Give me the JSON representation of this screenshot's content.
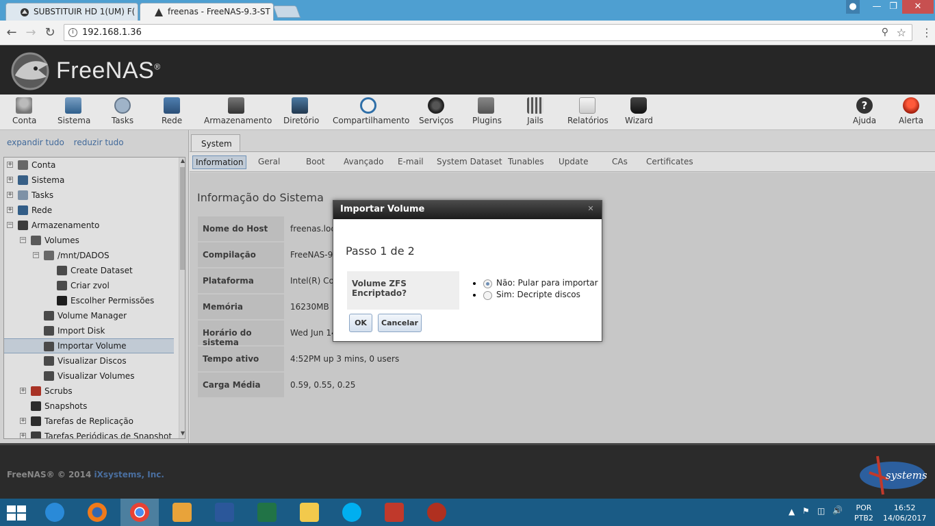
{
  "browser": {
    "tabs": [
      {
        "title": "SUBSTITUIR HD 1(UM) F(",
        "active": false
      },
      {
        "title": "freenas - FreeNAS-9.3-ST",
        "active": true
      }
    ],
    "url": "192.168.1.36"
  },
  "app": {
    "brand": "FreeNAS",
    "brand_mark": "®"
  },
  "toolbar": {
    "items": [
      {
        "label": "Conta",
        "icon": "users-icon"
      },
      {
        "label": "Sistema",
        "icon": "system-icon"
      },
      {
        "label": "Tasks",
        "icon": "tasks-icon"
      },
      {
        "label": "Rede",
        "icon": "network-icon"
      },
      {
        "label": "Armazenamento",
        "icon": "storage-icon"
      },
      {
        "label": "Diretório",
        "icon": "directory-icon"
      },
      {
        "label": "Compartilhamento",
        "icon": "sharing-icon"
      },
      {
        "label": "Serviços",
        "icon": "services-icon"
      },
      {
        "label": "Plugins",
        "icon": "plugins-icon"
      },
      {
        "label": "Jails",
        "icon": "jails-icon"
      },
      {
        "label": "Relatórios",
        "icon": "reports-icon"
      },
      {
        "label": "Wizard",
        "icon": "wizard-icon"
      },
      {
        "label": "Ajuda",
        "icon": "help-icon"
      },
      {
        "label": "Alerta",
        "icon": "alert-icon"
      }
    ]
  },
  "sidebar": {
    "expand_all": "expandir tudo",
    "collapse_all": "reduzir tudo",
    "tree": [
      {
        "label": "Conta",
        "toggle": "+"
      },
      {
        "label": "Sistema",
        "toggle": "+"
      },
      {
        "label": "Tasks",
        "toggle": "+"
      },
      {
        "label": "Rede",
        "toggle": "+"
      },
      {
        "label": "Armazenamento",
        "toggle": "−"
      },
      {
        "label": "Volumes",
        "toggle": "−"
      },
      {
        "label": "/mnt/DADOS",
        "toggle": "−"
      },
      {
        "label": "Create Dataset",
        "toggle": ""
      },
      {
        "label": "Criar zvol",
        "toggle": ""
      },
      {
        "label": "Escolher Permissões",
        "toggle": ""
      },
      {
        "label": "Volume Manager",
        "toggle": ""
      },
      {
        "label": "Import Disk",
        "toggle": ""
      },
      {
        "label": "Importar Volume",
        "toggle": "",
        "selected": true
      },
      {
        "label": "Visualizar Discos",
        "toggle": ""
      },
      {
        "label": "Visualizar Volumes",
        "toggle": ""
      },
      {
        "label": "Scrubs",
        "toggle": "+"
      },
      {
        "label": "Snapshots",
        "toggle": ""
      },
      {
        "label": "Tarefas de Replicação",
        "toggle": "+"
      },
      {
        "label": "Tarefas Periódicas de Snapshot",
        "toggle": "+"
      }
    ]
  },
  "main": {
    "top_tab": "System",
    "subtabs": [
      "Information",
      "Geral",
      "Boot",
      "Avançado",
      "E-mail",
      "System Dataset",
      "Tunables",
      "Update",
      "CAs",
      "Certificates"
    ],
    "active_subtab": "Information",
    "title": "Informação do Sistema",
    "info": [
      {
        "key": "Nome do Host",
        "value": "freenas.loc"
      },
      {
        "key": "Compilação",
        "value": "FreeNAS-9"
      },
      {
        "key": "Plataforma",
        "value": "Intel(R) Co"
      },
      {
        "key": "Memória",
        "value": "16230MB"
      },
      {
        "key": "Horário do sistema",
        "value": "Wed Jun 14"
      },
      {
        "key": "Tempo ativo",
        "value": "4:52PM up 3 mins, 0 users"
      },
      {
        "key": "Carga Média",
        "value": "0.59, 0.55, 0.25"
      }
    ]
  },
  "dialog": {
    "title": "Importar Volume",
    "step": "Passo 1 de 2",
    "question": "Volume ZFS Encriptado?",
    "options": [
      {
        "label": "Não: Pular para importar",
        "checked": true
      },
      {
        "label": "Sim: Decripte discos",
        "checked": false
      }
    ],
    "ok_label": "OK",
    "cancel_label": "Cancelar"
  },
  "footer": {
    "copyright": "FreeNAS® © 2014 ",
    "company": "iXsystems, Inc.",
    "logo_text": "systems"
  },
  "taskbar": {
    "language": "POR",
    "layout": "PTB2",
    "time": "16:52",
    "date": "14/06/2017"
  },
  "colors": {
    "accent": "#4a78b0",
    "header_bg": "#262626",
    "taskbar_bg": "#1a5b85",
    "tabstrip_bg": "#4e9fd1"
  }
}
